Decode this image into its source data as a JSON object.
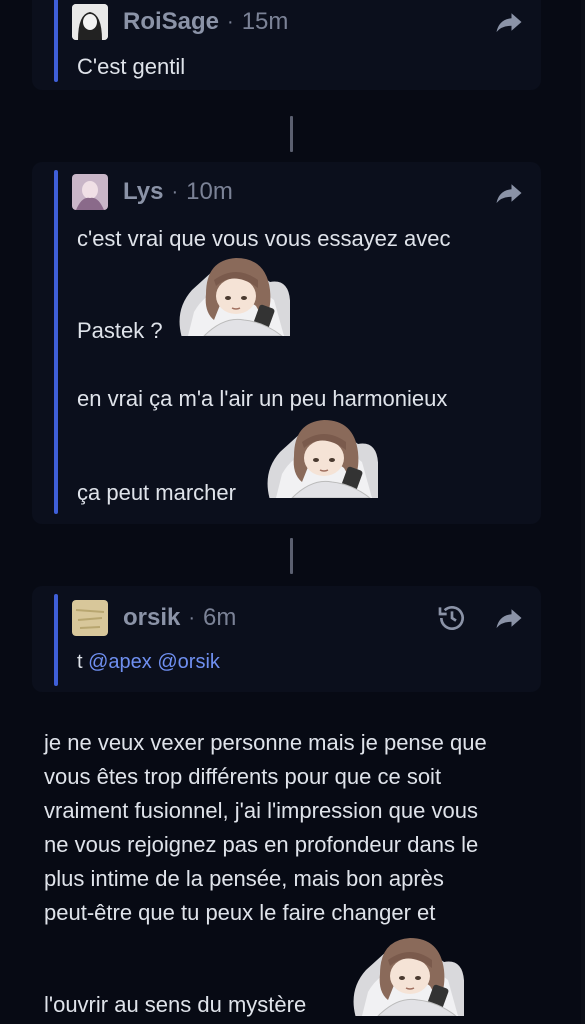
{
  "replies": [
    {
      "author": "RoiSage",
      "time": "15m",
      "lines": [
        "C'est gentil"
      ]
    },
    {
      "author": "Lys",
      "time": "10m",
      "lines": [
        "c'est vrai que vous vous essayez avec",
        "Pastek ?",
        "en vrai ça m'a l'air un peu harmonieux",
        "ça peut marcher"
      ]
    },
    {
      "author": "orsik",
      "time": "6m",
      "prefix": "t",
      "mentions": [
        "@apex",
        "@orsik"
      ]
    }
  ],
  "separator": "·",
  "post": {
    "lines": [
      "je ne veux vexer personne mais je pense que",
      "vous êtes trop différents pour que ce soit",
      "vraiment fusionnel, j'ai l'impression que vous",
      "ne vous rejoignez pas en profondeur dans le",
      "plus intime de la pensée, mais bon après",
      "peut-être que tu peux le faire changer et",
      "l'ouvrir au sens du mystère"
    ]
  },
  "colors": {
    "background": "#070a14",
    "card": "#0b0f1c",
    "accent": "#3f5fd8",
    "mention": "#6f8ff0",
    "muted": "#7b8296"
  },
  "icons": {
    "share": "share-arrow-icon",
    "history": "history-icon",
    "sticker": "anime-girl-in-bed-sticker"
  }
}
